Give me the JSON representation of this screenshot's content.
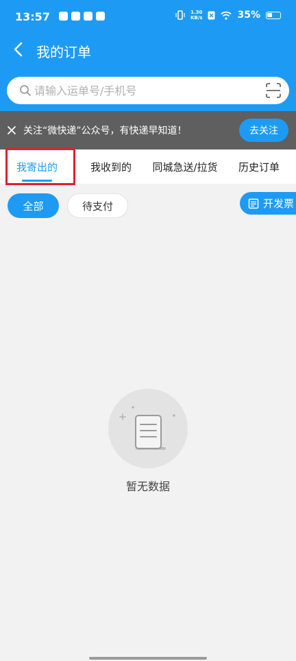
{
  "status_bar": {
    "time": "13:57",
    "net_speed_value": "1.30",
    "net_speed_unit": "KB/s",
    "battery": "35%"
  },
  "header": {
    "title": "我的订单"
  },
  "search": {
    "placeholder": "请输入运单号/手机号"
  },
  "banner": {
    "text": "关注“微快递”公众号，有快递早知道！",
    "follow_label": "去关注"
  },
  "tabs": [
    {
      "label": "我寄出的",
      "active": true
    },
    {
      "label": "我收到的",
      "active": false
    },
    {
      "label": "同城急送/拉货",
      "active": false
    },
    {
      "label": "历史订单",
      "active": false
    }
  ],
  "filters": {
    "all_label": "全部",
    "pending_label": "待支付"
  },
  "invoice": {
    "label": "开发票"
  },
  "empty": {
    "text": "暂无数据"
  },
  "colors": {
    "brand_blue": "#1d9bf4",
    "banner_gray": "#5f5f5f",
    "highlight_red": "#e0202a"
  }
}
